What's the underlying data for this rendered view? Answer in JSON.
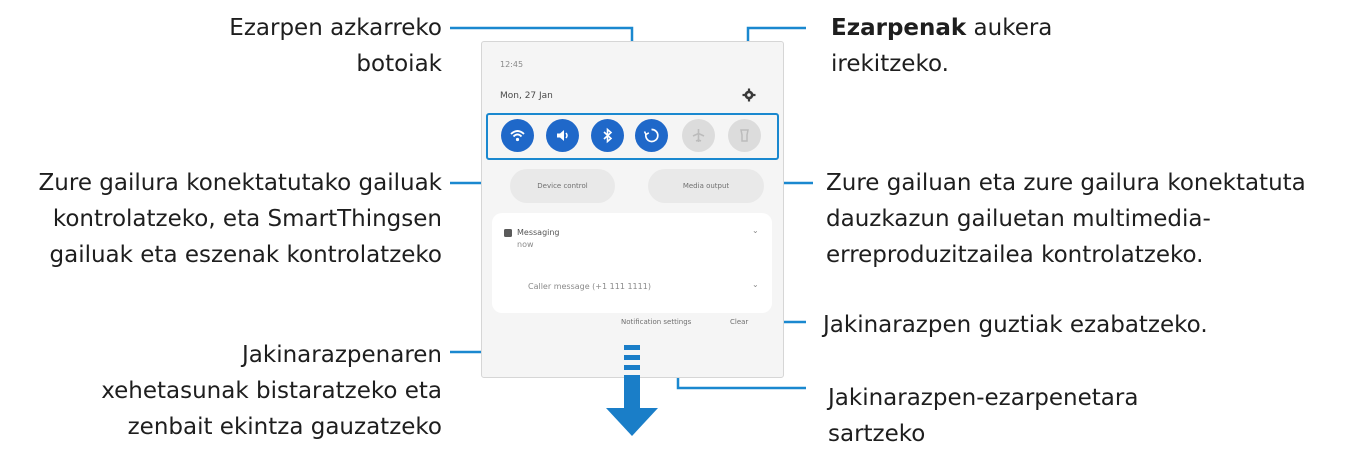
{
  "labels": {
    "quick_settings": [
      "Ezarpen azkarreko",
      "botoiak"
    ],
    "device_control": [
      "Zure gailura konektatutako gailuak",
      "kontrolatzeko, eta SmartThingsen",
      "gailuak eta eszenak kontrolatzeko"
    ],
    "notification_details": [
      "Jakinarazpenaren",
      "xehetasunak bistaratzeko eta",
      "zenbait ekintza gauzatzeko"
    ],
    "settings_bold": "Ezarpenak",
    "settings_rest": " aukera",
    "settings_line2": "irekitzeko.",
    "media_control": [
      "Zure gailuan eta zure gailura konektatuta",
      "dauzkazun gailuetan multimedia-",
      "erreproduzitzailea kontrolatzeko."
    ],
    "clear_all": "Jakinarazpen guztiak ezabatzeko.",
    "notification_settings": [
      "Jakinarazpen-ezarpenetara",
      "sartzeko"
    ]
  },
  "panel": {
    "status_text": "12:45",
    "date_text": "Mon, 27 Jan",
    "device_control_label": "Device control",
    "media_output_label": "Media output",
    "notification_app": "Messaging",
    "notification_sub": "now",
    "notification_line": "Caller message (+1 111 1111)",
    "notification_settings_label": "Notification settings",
    "clear_label": "Clear"
  },
  "quick_buttons": [
    {
      "icon": "wifi-icon",
      "state": "on"
    },
    {
      "icon": "sound-icon",
      "state": "on"
    },
    {
      "icon": "bluetooth-icon",
      "state": "on"
    },
    {
      "icon": "auto-rotate-icon",
      "state": "on"
    },
    {
      "icon": "airplane-icon",
      "state": "off"
    },
    {
      "icon": "flashlight-icon",
      "state": "off"
    }
  ],
  "colors": {
    "accent": "#1a88cf",
    "button_on": "#1f68c9",
    "arrow": "#1a7ec8",
    "text": "#1e1e1e"
  }
}
